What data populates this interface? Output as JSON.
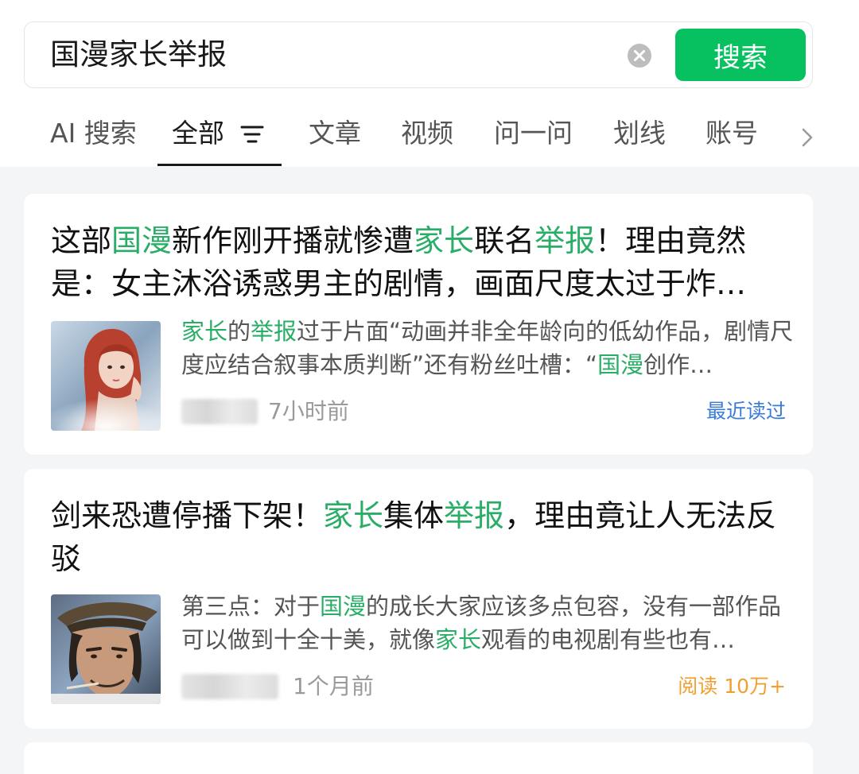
{
  "search": {
    "query": "国漫家长举报",
    "button_label": "搜索"
  },
  "tabs": [
    {
      "label": "AI 搜索"
    },
    {
      "label": "全部"
    },
    {
      "label": "文章"
    },
    {
      "label": "视频"
    },
    {
      "label": "问一问"
    },
    {
      "label": "划线"
    },
    {
      "label": "账号"
    }
  ],
  "results": [
    {
      "title_parts": [
        "这部",
        "国漫",
        "新作刚开播就惨遭",
        "家长",
        "联名",
        "举报",
        "！理由竟然是：女主沐浴诱惑男主的剧情，画面尺度太过于炸…"
      ],
      "snippet_parts": [
        "家长",
        "的",
        "举报",
        "过于片面“动画并非全年龄向的低幼作品，剧情尺度应结合叙事本质判断”还有粉丝吐槽：“",
        "国漫",
        "创作…"
      ],
      "time": "7小时前",
      "status": "最近读过"
    },
    {
      "title_parts": [
        "剑来恐遭停播下架！",
        "家长",
        "集体",
        "举报",
        "，理由竟让人无法反驳"
      ],
      "snippet_parts": [
        "第三点：对于",
        "国漫",
        "的成长大家应该多点包容，没有一部作品可以做到十全十美，就像",
        "家长",
        "观看的电视剧有些也有…"
      ],
      "time": "1个月前",
      "status": "阅读 10万+"
    }
  ],
  "colors": {
    "accent": "#07c160",
    "highlight": "#2aae67",
    "status_read": "#3a7bd5",
    "status_views": "#f0a030"
  },
  "icons": {
    "clear": "clear-icon",
    "filter": "filter-icon",
    "more": "chevron-right-icon"
  }
}
